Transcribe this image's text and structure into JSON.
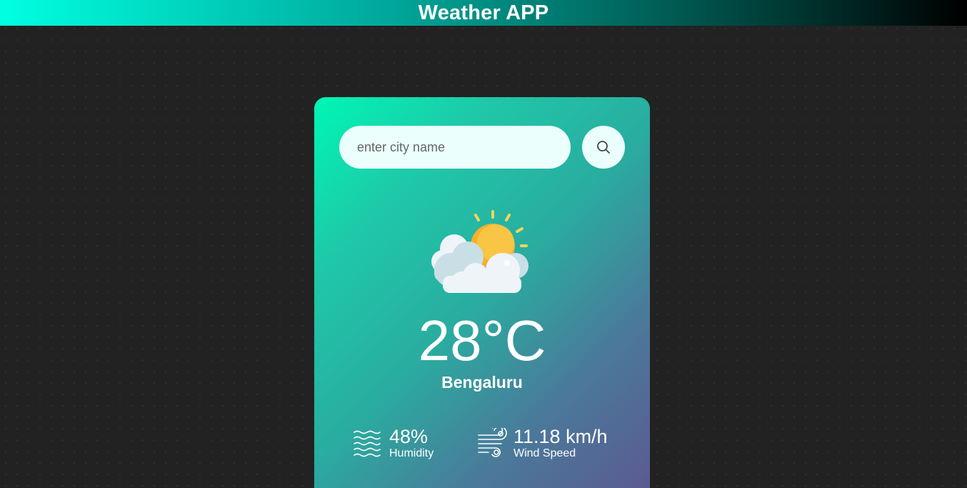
{
  "header": {
    "title": "Weather APP"
  },
  "search": {
    "placeholder": "enter city name",
    "value": ""
  },
  "weather": {
    "condition_icon": "partly-cloudy-icon",
    "temperature": "28°C",
    "city": "Bengaluru"
  },
  "details": {
    "humidity": {
      "value": "48%",
      "label": "Humidity",
      "icon": "humidity-waves-icon"
    },
    "wind": {
      "value": "11.18 km/h",
      "label": "Wind Speed",
      "icon": "wind-icon"
    }
  },
  "colors": {
    "background": "#222222",
    "card_gradient_start": "#00f7b5",
    "card_gradient_end": "#5b5a92",
    "header_gradient_start": "#00ffe1",
    "header_gradient_end": "#000000",
    "input_background": "#ebfffc"
  }
}
